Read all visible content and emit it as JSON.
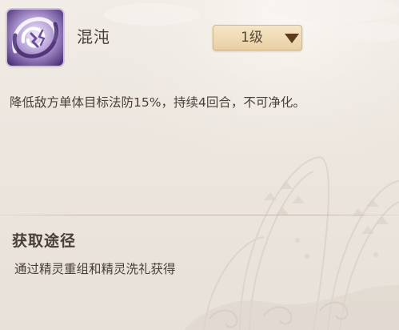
{
  "skill": {
    "name": "混沌",
    "icon": "chaos-swirl-icon",
    "level": "1级",
    "description": "降低敌方单体目标法防15%，持续4回合，不可净化。"
  },
  "source": {
    "heading": "获取途径",
    "text": "通过精灵重组和精灵洗礼获得"
  },
  "colors": {
    "background": "#ece7e1",
    "text": "#4a3f38",
    "level_button": "#ecd6ae",
    "icon_purple": "#7b5fa8"
  }
}
